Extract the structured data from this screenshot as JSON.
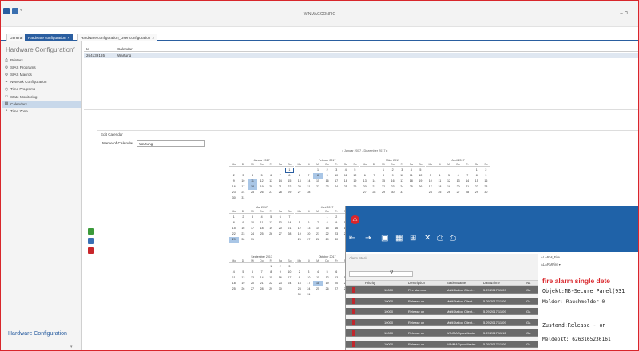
{
  "app": {
    "title": "WINMAGCONFIG",
    "window_control": "– ⊓"
  },
  "tabs": [
    {
      "label": "General"
    },
    {
      "label": "Hardware configuration",
      "close": "×"
    },
    {
      "label": "Hardware configuration_User configuration",
      "close": "×"
    }
  ],
  "sidebar": {
    "title": "Hardware Configuration",
    "pin": "‹",
    "items": [
      {
        "label": "Printers",
        "icon": "printer-icon"
      },
      {
        "label": "SIAS Programs",
        "icon": "program-icon"
      },
      {
        "label": "SIAS Macros",
        "icon": "macro-icon"
      },
      {
        "label": "Network Configuration",
        "icon": "network-icon"
      },
      {
        "label": "Time Programs",
        "icon": "time-program-icon"
      },
      {
        "label": "State Monitoring",
        "icon": "monitor-icon"
      },
      {
        "label": "Calendars",
        "icon": "calendar-icon"
      },
      {
        "label": "Time Zone",
        "icon": "clock-icon"
      }
    ],
    "selected_index": 6,
    "footer": "Hardware Configuration"
  },
  "grid": {
    "headers": [
      "Id",
      "Calendar"
    ],
    "rows": [
      [
        "264139165",
        "Wartung"
      ]
    ]
  },
  "edit_calendar": {
    "title": "Edit Calendar",
    "name_label": "Name of Calendar",
    "name_value": "Wartung",
    "range_label": "◂ Januar 2017 - Dezember 2017 ▸",
    "weekdays": [
      "Mo",
      "Di",
      "Mi",
      "Do",
      "Fr",
      "Sa",
      "So"
    ],
    "months": [
      {
        "title": "Januar 2017",
        "start": 6,
        "days": 31,
        "highlight": [
          11,
          18
        ],
        "today": 1
      },
      {
        "title": "Februar 2017",
        "start": 2,
        "days": 28,
        "highlight": [
          8
        ],
        "today": 0
      },
      {
        "title": "März 2017",
        "start": 2,
        "days": 31,
        "highlight": [],
        "today": 0
      },
      {
        "title": "April 2017",
        "start": 5,
        "days": 30,
        "highlight": [],
        "today": 0
      },
      {
        "title": "Mai 2017",
        "start": 0,
        "days": 31,
        "highlight": [
          29
        ],
        "today": 0
      },
      {
        "title": "Juni 2017",
        "start": 3,
        "days": 30,
        "highlight": [],
        "today": 0
      },
      {
        "title": "September 2017",
        "start": 4,
        "days": 30,
        "highlight": [],
        "today": 0
      },
      {
        "title": "Oktober 2017",
        "start": 6,
        "days": 31,
        "highlight": [
          18
        ],
        "today": 0
      }
    ]
  },
  "alarm_window": {
    "pane_title": "Alarm Stack",
    "headers": [
      "Priority",
      "Description",
      "StationName",
      "Date&Time",
      "Na"
    ],
    "rows": [
      {
        "priority": "10000",
        "description": "Fire alarm on",
        "station": "MultiStation Client...",
        "datetime": "5.29.2017 11:09",
        "na": "Ga"
      },
      {
        "priority": "10000",
        "description": "Release on",
        "station": "MultiStation Client...",
        "datetime": "5.29.2017 11:09",
        "na": "Ga"
      },
      {
        "priority": "10000",
        "description": "Release on",
        "station": "MultiStation Client...",
        "datetime": "5.29.2017 11:09",
        "na": "Ga"
      },
      {
        "priority": "10000",
        "description": "Release on",
        "station": "MultiStation Client...",
        "datetime": "5.29.2017 11:09",
        "na": "Ga"
      },
      {
        "priority": "10000",
        "description": "Release on",
        "station": "WINMAGplusMaster",
        "datetime": "5.29.2017 11:12",
        "na": "Ga"
      },
      {
        "priority": "10000",
        "description": "Release on",
        "station": "WINMAGplusMaster",
        "datetime": "5.29.2017 11:09",
        "na": "Ga"
      }
    ],
    "detail": {
      "title": "ALARM_Fire",
      "toolbar": "ALARMFire ▾",
      "alarm": "fire alarm single dete",
      "objekt": "Objekt:MB-Secure Panel(931",
      "melder": "Melder:     Rauchmelder 0",
      "zustand": "Zustand:Release - on",
      "meldepkt": "Meldepkt:    6263165236161"
    }
  }
}
